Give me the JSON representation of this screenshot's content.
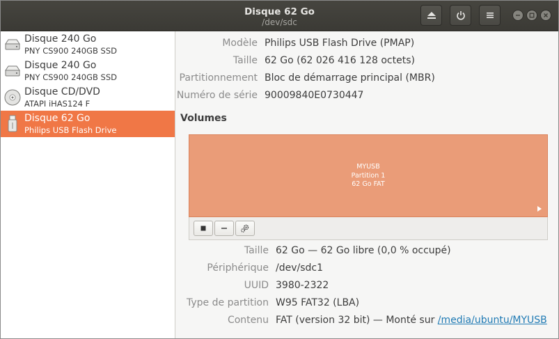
{
  "header": {
    "title": "Disque 62 Go",
    "subtitle": "/dev/sdc",
    "buttons": {
      "eject": "eject-icon",
      "power": "power-icon",
      "menu": "menu-icon"
    }
  },
  "sidebar": {
    "drives": [
      {
        "name": "Disque 240 Go",
        "model": "PNY CS900 240GB SSD",
        "icon": "hard-disk-icon"
      },
      {
        "name": "Disque 240 Go",
        "model": "PNY CS900 240GB SSD",
        "icon": "hard-disk-icon"
      },
      {
        "name": "Disque CD/DVD",
        "model": "ATAPI   iHAS124   F",
        "icon": "optical-disc-icon"
      },
      {
        "name": "Disque 62 Go",
        "model": "Philips USB Flash Drive",
        "icon": "usb-drive-icon",
        "selected": true
      }
    ]
  },
  "disk": {
    "model_label": "Modèle",
    "model": "Philips USB Flash Drive (PMAP)",
    "size_label": "Taille",
    "size": "62 Go (62 026 416 128 octets)",
    "partitioning_label": "Partitionnement",
    "partitioning": "Bloc de démarrage principal (MBR)",
    "serial_label": "Numéro de série",
    "serial": "90009840E0730447"
  },
  "volumes": {
    "title": "Volumes",
    "volume": {
      "name": "MYUSB",
      "partition": "Partition 1",
      "desc": "62 Go FAT"
    },
    "accent": "#ea9c78"
  },
  "partition": {
    "size_label": "Taille",
    "size": "62 Go — 62 Go libre (0,0 % occupé)",
    "device_label": "Périphérique",
    "device": "/dev/sdc1",
    "uuid_label": "UUID",
    "uuid": "3980-2322",
    "type_label": "Type de partition",
    "type": "W95 FAT32 (LBA)",
    "content_label": "Contenu",
    "content_prefix": "FAT (version 32 bit) — Monté sur ",
    "content_link": "/media/ubuntu/MYUSB"
  },
  "colors": {
    "selection": "#f07746",
    "titlebar": "#3b3a35",
    "close": "#e95420"
  }
}
